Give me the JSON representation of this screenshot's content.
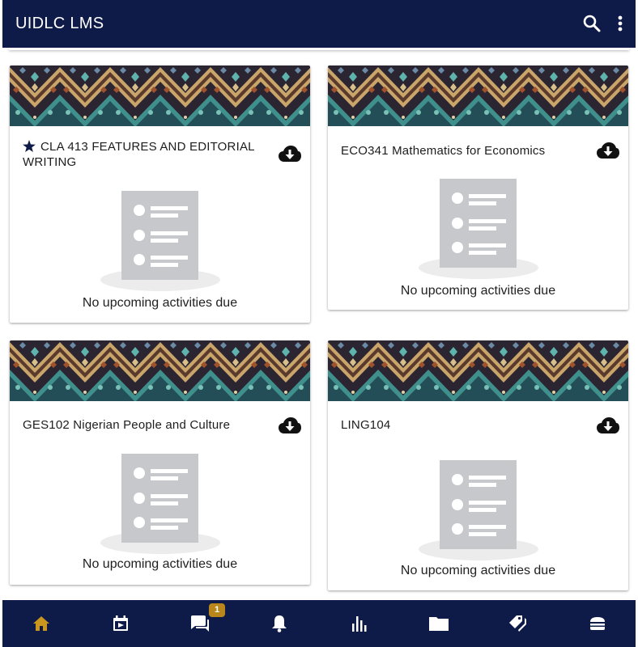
{
  "app_bar": {
    "title": "UIDLC LMS"
  },
  "courses": [
    {
      "name": "CLA 413 FEATURES AND EDITORIAL WRITING",
      "starred": true,
      "status": "No upcoming activities due"
    },
    {
      "name": "ECO341 Mathematics for Economics",
      "starred": false,
      "status": "No upcoming activities due"
    },
    {
      "name": "GES102 Nigerian People and Culture",
      "starred": false,
      "status": "No upcoming activities due"
    },
    {
      "name": "LING104",
      "starred": false,
      "status": "No upcoming activities due"
    }
  ],
  "bottom_nav": {
    "items": [
      "home-icon",
      "calendar-icon",
      "messages-icon",
      "notifications-icon",
      "grades-icon",
      "files-icon",
      "tags-icon",
      "menu-icon"
    ],
    "active": "home-icon",
    "messages_badge": "1"
  },
  "colors": {
    "primary": "#0e1a47",
    "accent": "#c9961e",
    "badge": "#b8861a",
    "placeholder": "#c7c9cc"
  }
}
